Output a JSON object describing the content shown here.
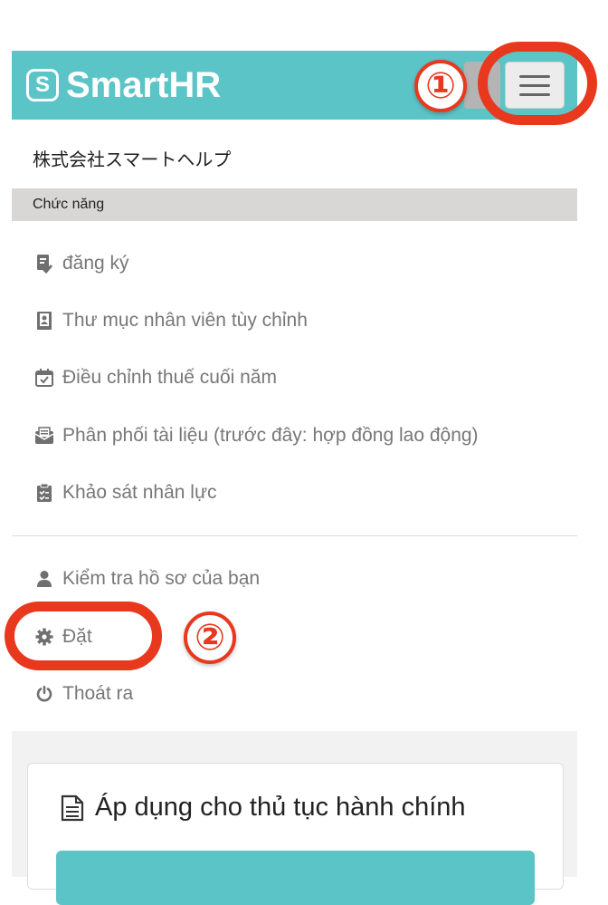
{
  "header": {
    "logo_mark": "S",
    "logo_text": "SmartHR",
    "brand_color": "#5bc4c6",
    "menu_icon": "hamburger-icon"
  },
  "company_name": "株式会社スマートヘルプ",
  "section_label": "Chức năng",
  "features": [
    {
      "label": "đăng ký",
      "icon": "clipboard-check-icon"
    },
    {
      "label": "Thư mục nhân viên tùy chỉnh",
      "icon": "contact-book-icon"
    },
    {
      "label": "Điều chỉnh thuế cuối năm",
      "icon": "calendar-check-icon"
    },
    {
      "label": "Phân phối tài liệu (trước đây: hợp đồng lao động)",
      "icon": "envelope-document-icon"
    },
    {
      "label": "Khảo sát nhân lực",
      "icon": "survey-clipboard-icon"
    }
  ],
  "account_menu": [
    {
      "label": "Kiểm tra hồ sơ của bạn",
      "icon": "user-icon"
    },
    {
      "label": "Đặt",
      "icon": "gear-icon"
    },
    {
      "label": "Thoát ra",
      "icon": "power-icon"
    }
  ],
  "card": {
    "title": "Áp dụng cho thủ tục hành chính",
    "icon": "document-icon"
  },
  "annotations": {
    "step1": "①",
    "step2": "②",
    "color": "#e8391e"
  }
}
